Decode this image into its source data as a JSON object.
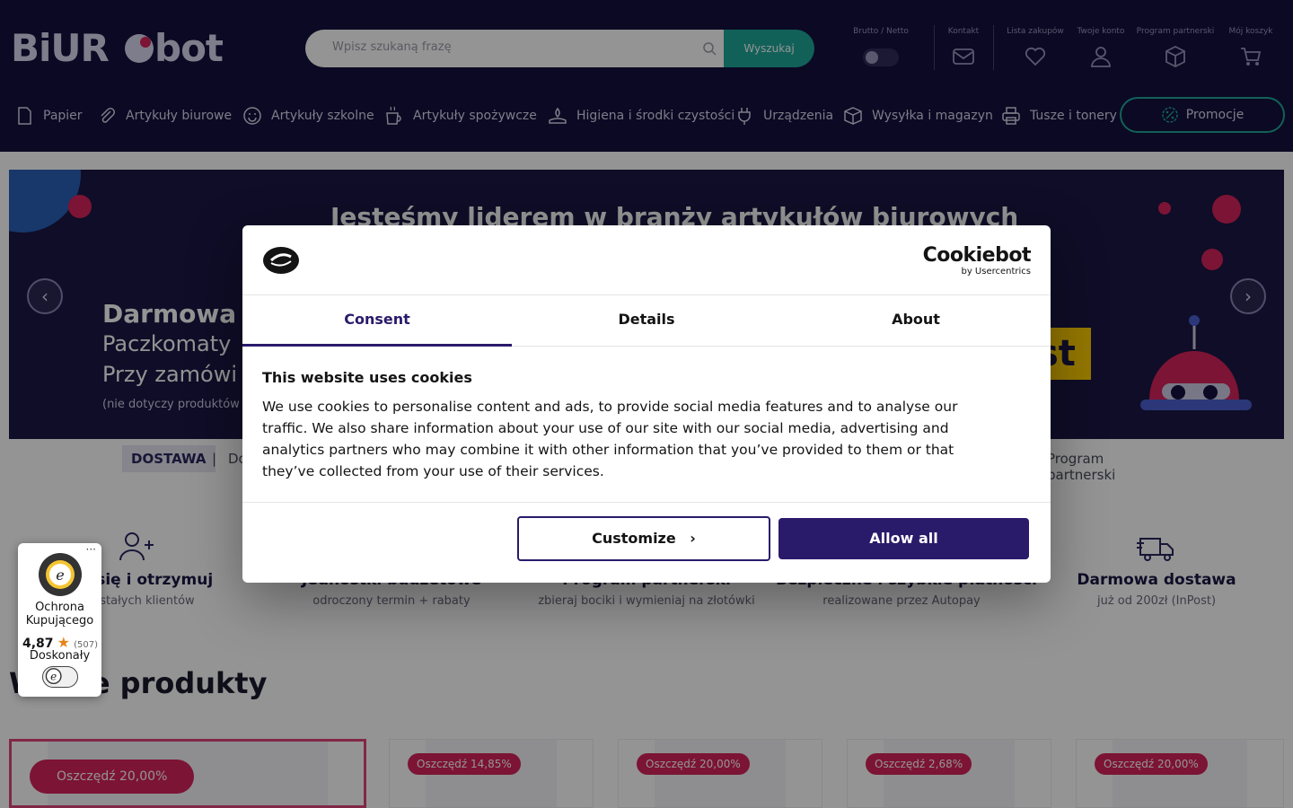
{
  "header": {
    "logo_text": "BiURObot",
    "search_placeholder": "Wpisz szukaną frazę",
    "search_button": "Wyszukaj",
    "brutto_netto": "Brutto / Netto",
    "kontakt": "Kontakt",
    "lista": "Lista zakupów",
    "konto": "Twoje konto",
    "program": "Program partnerski",
    "koszyk": "Mój koszyk"
  },
  "nav": {
    "items": [
      "Papier",
      "Artykuły biurowe",
      "Artykuły szkolne",
      "Artykuły spożywcze",
      "Higiena i środki czystości",
      "Urządzenia",
      "Wysyłka i magazyn",
      "Tusze i tonery"
    ],
    "promo": "Promocje"
  },
  "banner": {
    "heading": "Jesteśmy liderem w branży artykułów biurowych",
    "title": "Darmowa d",
    "line1": "Paczkomaty",
    "line2": "Przy zamówi",
    "note": "(nie dotyczy produktów",
    "brand_fragment": "st",
    "prev": "‹",
    "next": "›"
  },
  "tabs": {
    "dostawa": "DOSTAWA",
    "sep": "|",
    "do": "Do",
    "partner": "Program partnerski"
  },
  "features": [
    {
      "title": "truj się i otrzymuj",
      "sub": "dla stałych klientów"
    },
    {
      "title": "Jednostki budżetowe",
      "sub": "odroczony termin + rabaty"
    },
    {
      "title": "Program partnerski",
      "sub": "zbieraj bociki i wymieniaj na złotówki"
    },
    {
      "title": "Bezpieczne i szybkie płatności",
      "sub": "realizowane przez Autopay"
    },
    {
      "title": "Darmowa dostawa",
      "sub": "już od 200zł (InPost)"
    }
  ],
  "section_title": "Wyróżnione produkty",
  "section_title_visible": "W          ane produkty",
  "products": [
    {
      "badge": "Oszczędź 20,00%"
    },
    {
      "badge": "Oszczędź 14,85%"
    },
    {
      "badge": "Oszczędź 20,00%"
    },
    {
      "badge": "Oszczędź 2,68%"
    },
    {
      "badge": "Oszczędź 20,00%"
    }
  ],
  "cookie": {
    "brand": "Cookiebot",
    "brand_sub": "by Usercentrics",
    "tabs": [
      "Consent",
      "Details",
      "About"
    ],
    "heading": "This website uses cookies",
    "text": "We use cookies to personalise content and ads, to provide social media features and to analyse our traffic. We also share information about your use of our site with our social media, advertising and analytics partners who may combine it with other information that you’ve provided to them or that they’ve collected from your use of their services.",
    "customize": "Customize",
    "allow": "Allow all"
  },
  "trusted": {
    "title": "Ochrona Kupującego",
    "score": "4,87",
    "count": "(507)",
    "verdict": "Doskonały"
  },
  "colors": {
    "header_bg": "#13113d",
    "accent_teal": "#1fa89a",
    "accent_pink": "#d6245c",
    "cookie_purple": "#2a1a6a"
  }
}
